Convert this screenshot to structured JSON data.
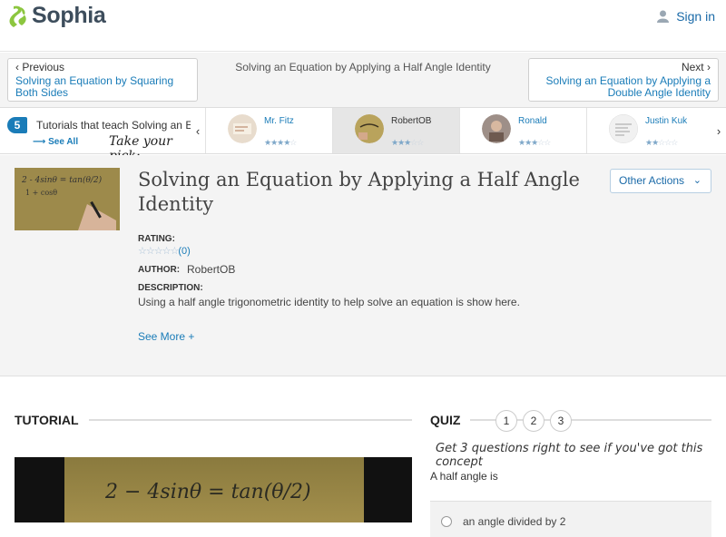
{
  "header": {
    "logo_text": "Sophia",
    "sign_in_label": "Sign in"
  },
  "nav": {
    "previous_label": "Previous",
    "previous_link": "Solving an Equation by Squaring Both Sides",
    "current_title": "Solving an Equation by Applying a Half Angle Identity",
    "next_label": "Next",
    "next_link": "Solving an Equation by Applying a Double Angle Identity"
  },
  "carousel": {
    "count": "5",
    "title": "Tutorials that teach Solving an E",
    "see_all": "See All",
    "take_your_pick": "Take your pick:",
    "cards": [
      {
        "name": "Mr. Fitz",
        "rating": 4,
        "selected": false
      },
      {
        "name": "RobertOB",
        "rating": 3,
        "selected": true
      },
      {
        "name": "Ronald",
        "rating": 3,
        "selected": false
      },
      {
        "name": "Justin Kuk",
        "rating": 2.5,
        "selected": false
      }
    ]
  },
  "tutorial": {
    "title": "Solving an Equation by Applying a Half Angle Identity",
    "other_actions_label": "Other Actions",
    "rating_label": "RATING:",
    "rating_count": "(0)",
    "author_label": "AUTHOR:",
    "author": "RobertOB",
    "description_label": "DESCRIPTION:",
    "description": "Using a half angle trigonometric identity to help solve an equation is show here.",
    "see_more": "See More +"
  },
  "sections": {
    "tutorial_heading": "TUTORIAL",
    "video_text": "2 − 4sinθ  = tan(θ/2)"
  },
  "quiz": {
    "heading": "QUIZ",
    "numbers": [
      "1",
      "2",
      "3"
    ],
    "hint": "Get 3 questions right to see if you've got this concept",
    "question": "A half angle is",
    "first_answer": "an angle divided by 2"
  },
  "colors": {
    "brand_green": "#8cc63f",
    "link_blue": "#1a7cb8",
    "badge_blue": "#1a7cb8"
  }
}
